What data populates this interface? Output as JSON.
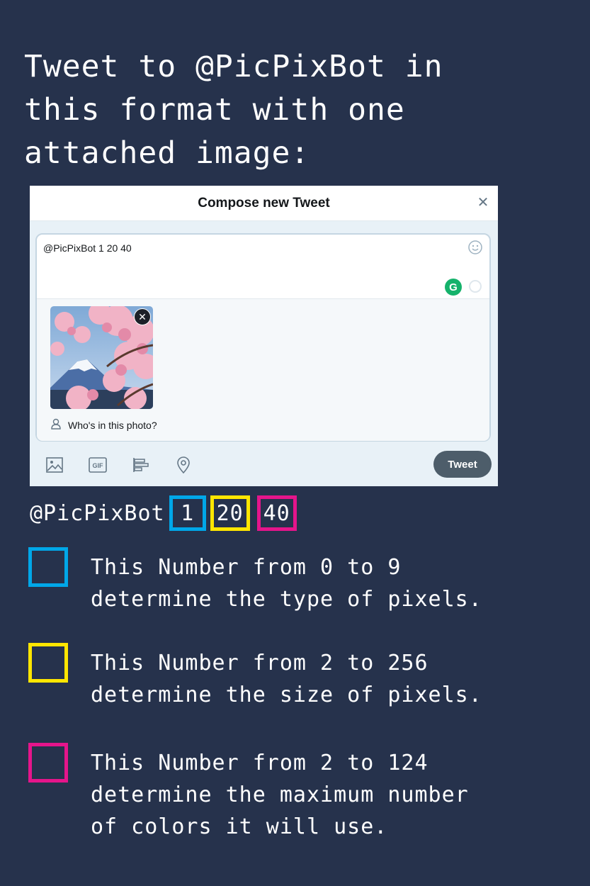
{
  "headline": "Tweet to @PicPixBot in\nthis format with one\nattached image:",
  "composer": {
    "title": "Compose new Tweet",
    "close_icon": "close-icon",
    "tweet_text": "@PicPixBot 1 20 40",
    "tag_people_label": "Who's in this photo?",
    "tools": [
      "image-icon",
      "gif-icon",
      "poll-icon",
      "location-icon"
    ],
    "gif_label": "GIF",
    "tweet_button": "Tweet",
    "grammarly_label": "G"
  },
  "format": {
    "handle": "@PicPixBot",
    "numbers": [
      {
        "value": "1",
        "color": "#00a7e8"
      },
      {
        "value": "20",
        "color": "#ffe600"
      },
      {
        "value": "40",
        "color": "#e5158b"
      }
    ]
  },
  "legend": [
    {
      "color": "#00a7e8",
      "text": "This Number from 0 to 9\ndetermine the type of pixels."
    },
    {
      "color": "#ffe600",
      "text": "This Number from 2 to 256\ndetermine the size of pixels."
    },
    {
      "color": "#e5158b",
      "text": "This Number from 2 to 124\ndetermine the maximum number\nof colors it will use."
    }
  ],
  "colors": {
    "background": "#26324c",
    "tweet_button": "#4d5d6a",
    "grammarly": "#15b26b"
  }
}
